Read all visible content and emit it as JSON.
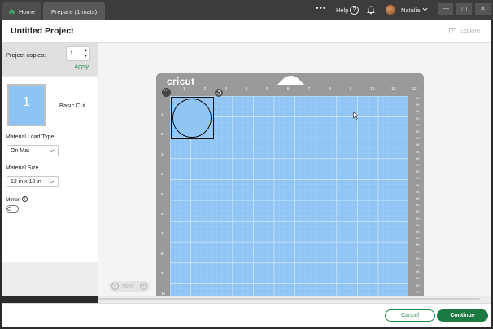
{
  "titlebar": {
    "tabs": [
      {
        "label": "Home",
        "icon": "home-icon"
      },
      {
        "label": "Prepare (1 mats)"
      }
    ],
    "more_glyph": "•••",
    "help_label": "Help",
    "help_glyph": "?",
    "user_name": "Natalia",
    "window_controls": {
      "minimize": "—",
      "maximize": "▢",
      "close": "✕"
    }
  },
  "header": {
    "project_title": "Untitled Project",
    "explore_label": "Explore"
  },
  "left_panel": {
    "project_copies_label": "Project copies:",
    "project_copies_value": "1",
    "stepper_up": "▲",
    "stepper_down": "▼",
    "apply_label": "Apply",
    "mat_number": "1",
    "mat_cut_label": "Basic Cut",
    "material_load_type_label": "Material Load Type",
    "material_load_type_value": "On Mat",
    "material_size_label": "Material Size",
    "material_size_value": "12 in x 12 in",
    "mirror_label": "Mirror",
    "info_glyph": "i",
    "mirror_on": false
  },
  "canvas": {
    "brand": "cricut",
    "ruler_top": [
      "1",
      "2",
      "3",
      "4",
      "5",
      "6",
      "7",
      "8",
      "9",
      "10",
      "11",
      "12"
    ],
    "ruler_left": [
      "1",
      "2",
      "3",
      "4",
      "5",
      "6",
      "7",
      "8",
      "9",
      "10"
    ],
    "ruler_right": [
      "0K",
      "0K",
      "0K",
      "0K",
      "0K",
      "0K",
      "0K",
      "0K",
      "0K",
      "0K",
      "0K",
      "0K",
      "0K",
      "0K",
      "0K",
      "0K",
      "0K",
      "0K",
      "0K",
      "0K",
      "0K",
      "0K",
      "0K",
      "0K",
      "0K",
      "0K",
      "0K",
      "0K",
      "0K",
      "0K"
    ],
    "object_menu_glyph": "•••",
    "zoom_minus": "−",
    "zoom_plus": "+",
    "zoom_level": "75%"
  },
  "footer": {
    "cancel_label": "Cancel",
    "continue_label": "Continue"
  },
  "colors": {
    "accent": "#1a7a42",
    "mat_blue": "#90c5f5",
    "mat_frame": "#9a9a9a"
  }
}
